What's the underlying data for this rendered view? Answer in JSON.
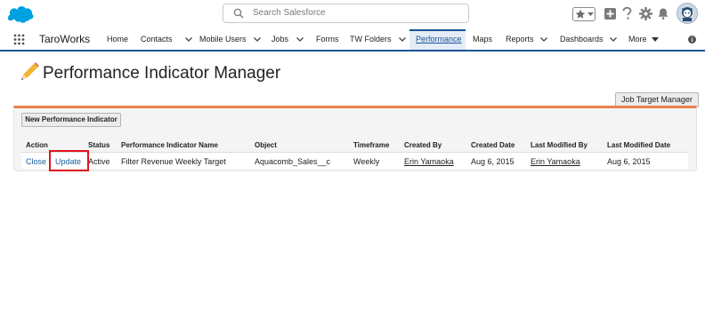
{
  "header": {
    "search_placeholder": "Search Salesforce"
  },
  "nav": {
    "app_name": "TaroWorks",
    "items": [
      {
        "label": "Home"
      },
      {
        "label": "Contacts"
      },
      {
        "label": "Mobile Users"
      },
      {
        "label": "Jobs"
      },
      {
        "label": "Forms"
      },
      {
        "label": "TW Folders"
      },
      {
        "label": "Performance"
      },
      {
        "label": "Maps"
      },
      {
        "label": "Reports"
      },
      {
        "label": "Dashboards"
      },
      {
        "label": "More"
      }
    ]
  },
  "page": {
    "title": "Performance Indicator Manager",
    "job_target_button": "Job Target Manager",
    "new_button": "New Performance Indicator"
  },
  "table": {
    "columns": [
      "Action",
      "Status",
      "Performance Indicator Name",
      "Object",
      "Timeframe",
      "Created By",
      "Created Date",
      "Last Modified By",
      "Last Modified Date"
    ],
    "rows": [
      {
        "action_close": "Close",
        "action_update": "Update",
        "status": "Active",
        "name": "Filter Revenue Weekly Target",
        "object": "Aquacomb_Sales__c",
        "timeframe": "Weekly",
        "created_by": "Erin Yamaoka",
        "created_date": "Aug 6, 2015",
        "modified_by": "Erin Yamaoka",
        "modified_date": "Aug 6, 2015"
      }
    ]
  },
  "colors": {
    "brand_blue": "#1b5297",
    "salesforce_cloud": "#00a1e0",
    "panel_accent": "#e9814b",
    "highlight": "#e0141e",
    "link": "#1a5fa3"
  }
}
